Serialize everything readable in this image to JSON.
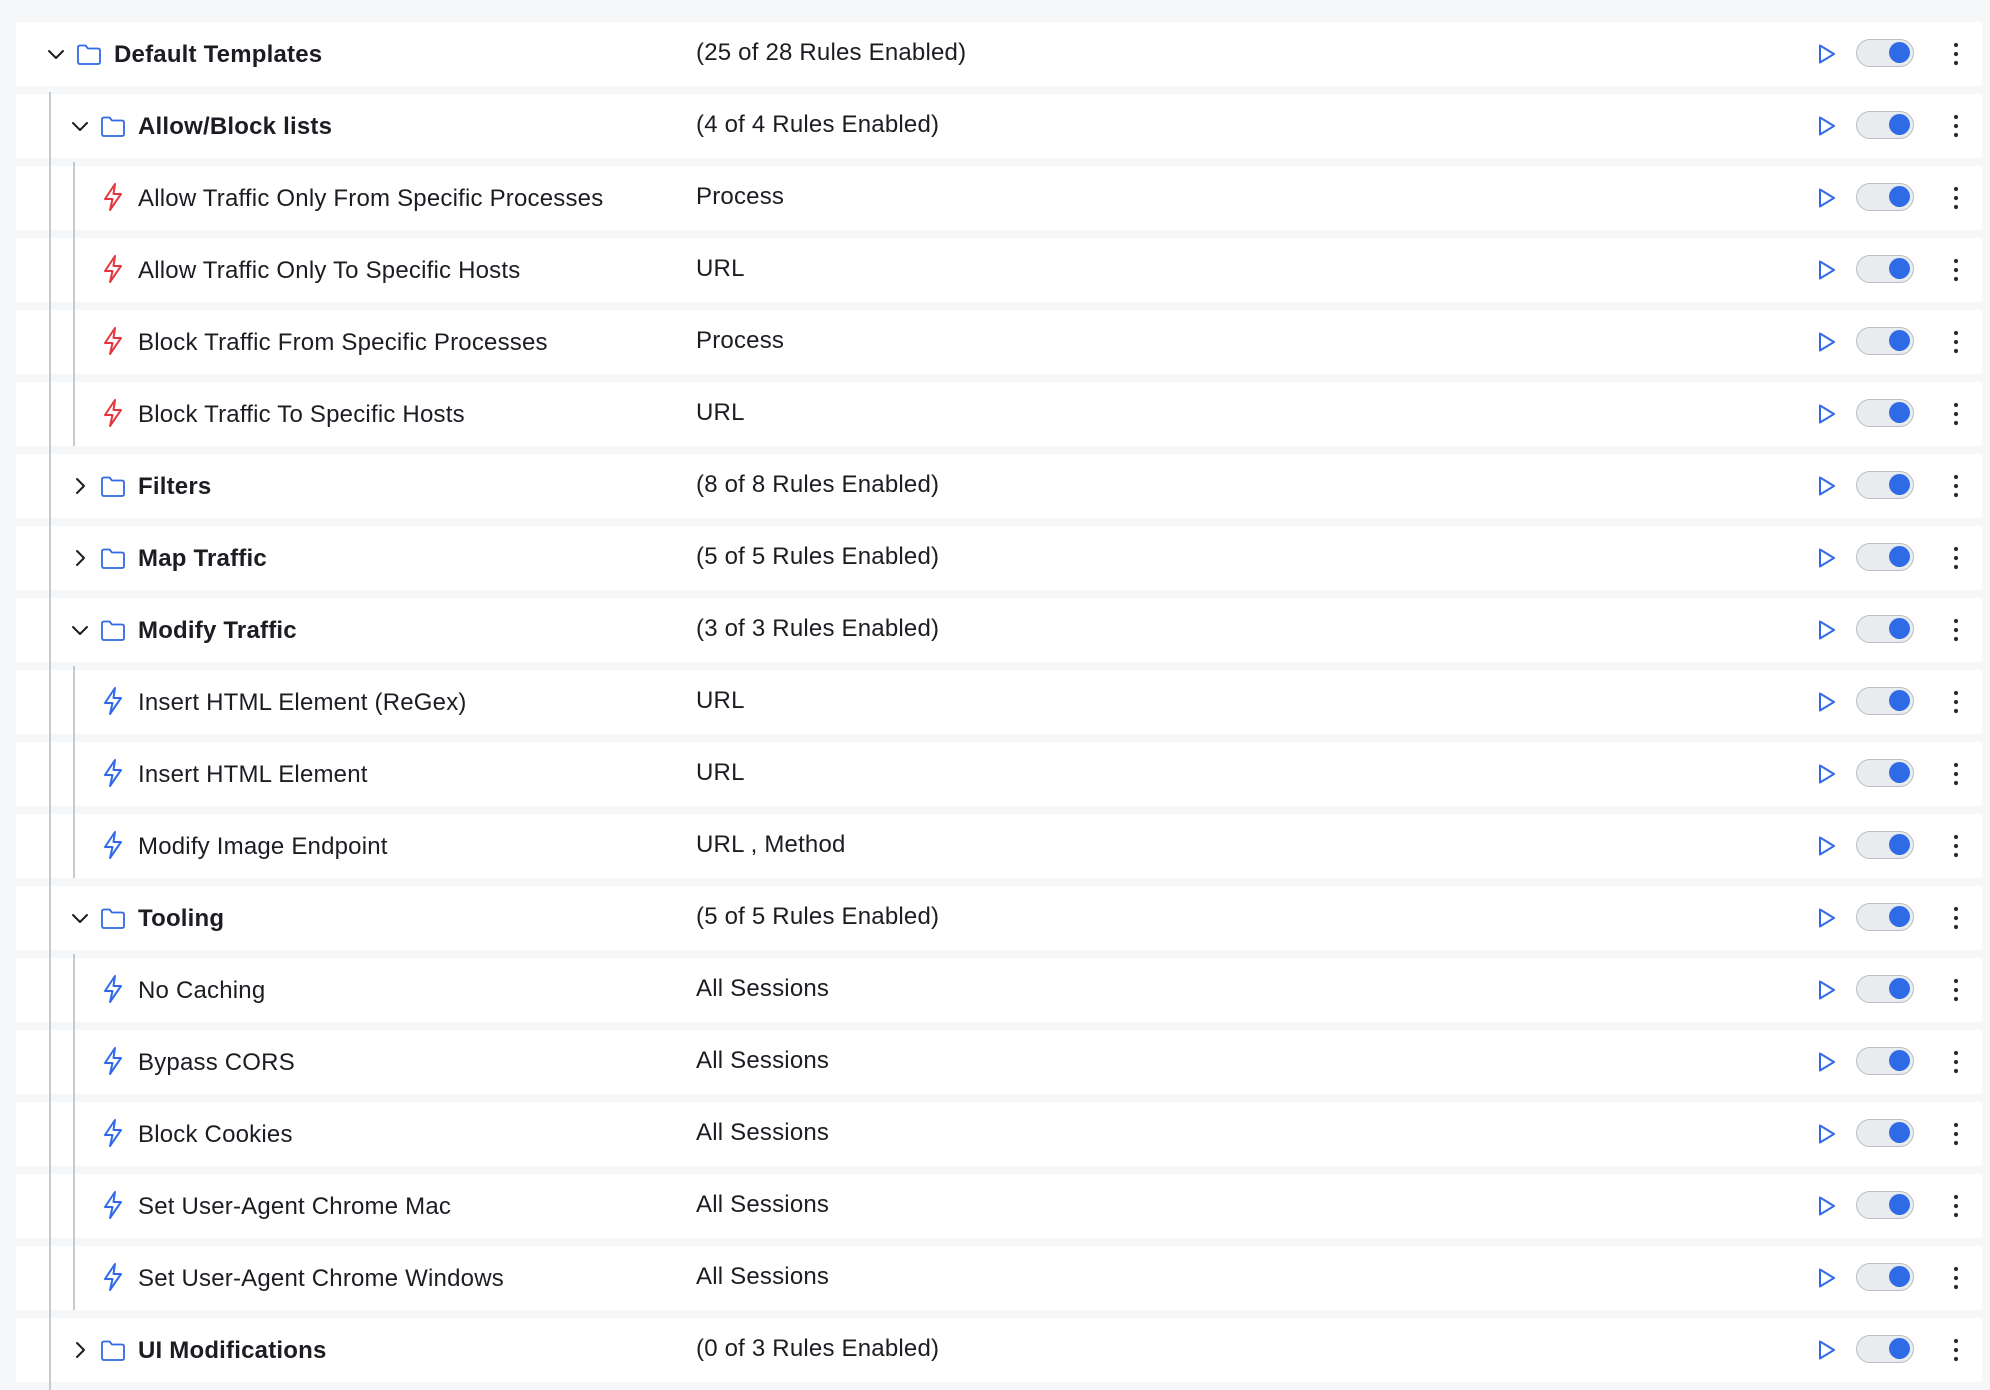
{
  "colors": {
    "accent": "#2f6be6",
    "folder_icon": "#2f6be6",
    "bolt_red": "#e0393e",
    "bolt_blue": "#2f6be6"
  },
  "rows": [
    {
      "type": "folder",
      "level": 0,
      "expanded": true,
      "name": "Default Templates",
      "info": "(25 of 28 Rules Enabled)",
      "enabled": true
    },
    {
      "type": "folder",
      "level": 1,
      "expanded": true,
      "name": "Allow/Block lists",
      "info": "(4 of 4 Rules Enabled)",
      "enabled": true
    },
    {
      "type": "rule",
      "level": 2,
      "bolt": "red",
      "name": "Allow Traffic Only From Specific Processes",
      "info": "Process",
      "enabled": true
    },
    {
      "type": "rule",
      "level": 2,
      "bolt": "red",
      "name": "Allow Traffic Only To Specific Hosts",
      "info": "URL",
      "enabled": true
    },
    {
      "type": "rule",
      "level": 2,
      "bolt": "red",
      "name": "Block Traffic From Specific Processes",
      "info": "Process",
      "enabled": true
    },
    {
      "type": "rule",
      "level": 2,
      "bolt": "red",
      "name": "Block Traffic To Specific Hosts",
      "info": "URL",
      "enabled": true
    },
    {
      "type": "folder",
      "level": 1,
      "expanded": false,
      "name": "Filters",
      "info": "(8 of 8 Rules Enabled)",
      "enabled": true
    },
    {
      "type": "folder",
      "level": 1,
      "expanded": false,
      "name": "Map Traffic",
      "info": "(5 of 5 Rules Enabled)",
      "enabled": true
    },
    {
      "type": "folder",
      "level": 1,
      "expanded": true,
      "name": "Modify Traffic",
      "info": "(3 of 3 Rules Enabled)",
      "enabled": true
    },
    {
      "type": "rule",
      "level": 2,
      "bolt": "blue",
      "name": "Insert HTML Element (ReGex)",
      "info": "URL",
      "enabled": true
    },
    {
      "type": "rule",
      "level": 2,
      "bolt": "blue",
      "name": "Insert HTML Element",
      "info": "URL",
      "enabled": true
    },
    {
      "type": "rule",
      "level": 2,
      "bolt": "blue",
      "name": "Modify Image Endpoint",
      "info": "URL , Method",
      "enabled": true
    },
    {
      "type": "folder",
      "level": 1,
      "expanded": true,
      "name": "Tooling",
      "info": "(5 of 5 Rules Enabled)",
      "enabled": true
    },
    {
      "type": "rule",
      "level": 2,
      "bolt": "blue",
      "name": "No Caching",
      "info": "All Sessions",
      "enabled": true
    },
    {
      "type": "rule",
      "level": 2,
      "bolt": "blue",
      "name": "Bypass CORS",
      "info": "All Sessions",
      "enabled": true
    },
    {
      "type": "rule",
      "level": 2,
      "bolt": "blue",
      "name": "Block Cookies",
      "info": "All Sessions",
      "enabled": true
    },
    {
      "type": "rule",
      "level": 2,
      "bolt": "blue",
      "name": "Set User-Agent Chrome Mac",
      "info": "All Sessions",
      "enabled": true
    },
    {
      "type": "rule",
      "level": 2,
      "bolt": "blue",
      "name": "Set User-Agent Chrome Windows",
      "info": "All Sessions",
      "enabled": true
    },
    {
      "type": "folder",
      "level": 1,
      "expanded": false,
      "name": "UI Modifications",
      "info": "(0 of 3 Rules Enabled)",
      "enabled": true
    }
  ]
}
